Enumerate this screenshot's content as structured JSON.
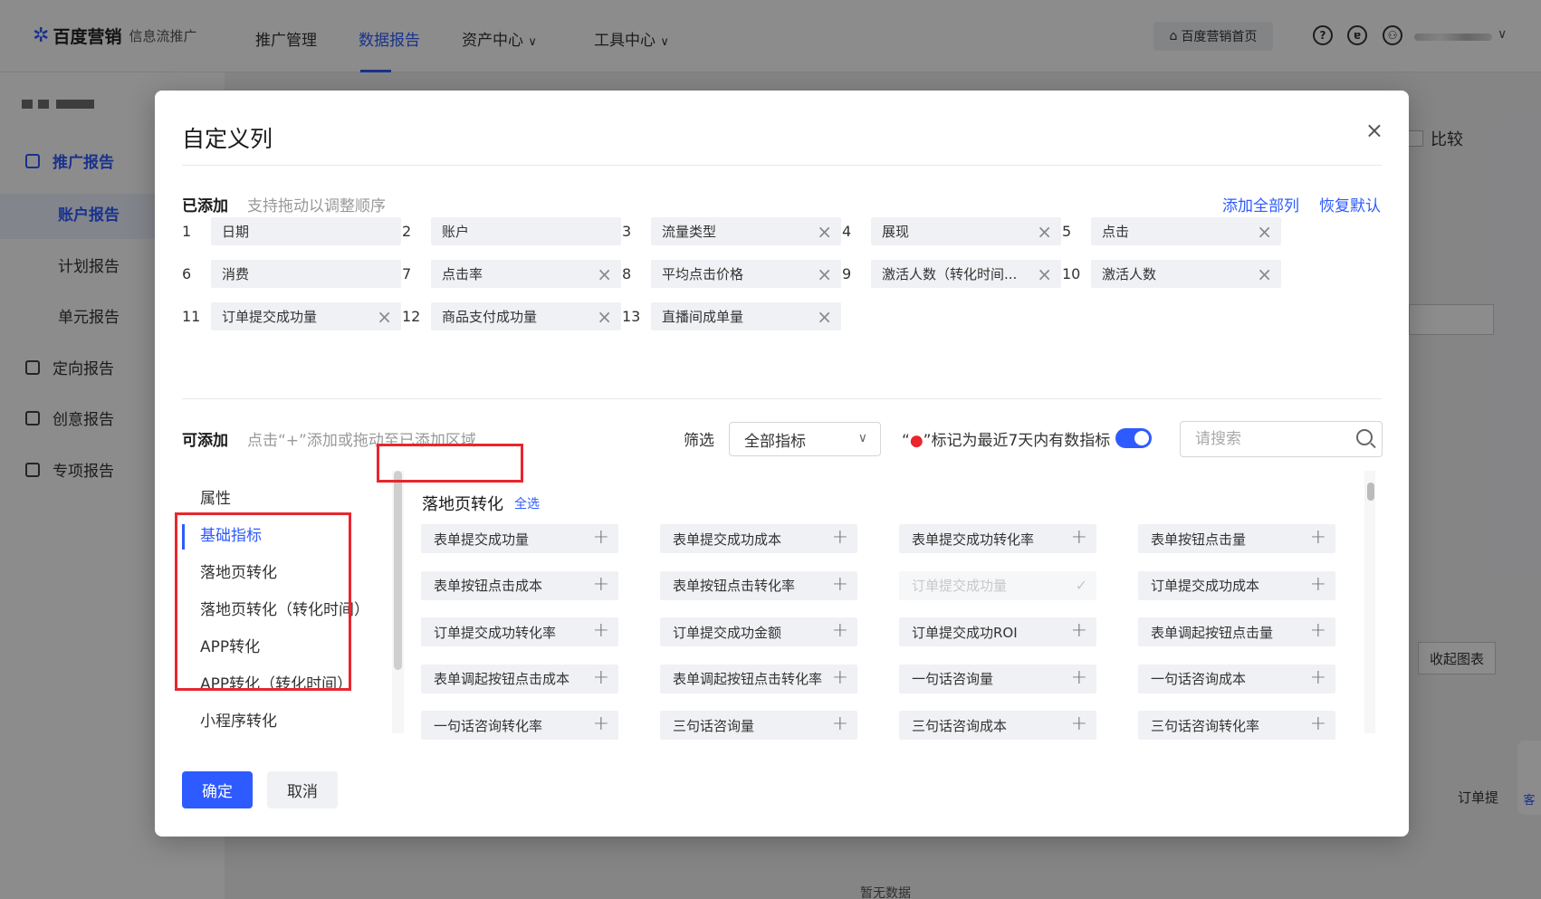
{
  "topbar": {
    "brand": "百度营销",
    "brand_sub": "信息流推广",
    "nav": [
      "推广管理",
      "数据报告",
      "资产中心",
      "工具中心"
    ],
    "active_nav": "数据报告",
    "home_button": "百度营销首页"
  },
  "sidebar": {
    "items": [
      "推广报告",
      "定向报告",
      "创意报告",
      "专项报告"
    ],
    "subitems": [
      "账户报告",
      "计划报告",
      "单元报告"
    ]
  },
  "background": {
    "compare_label": "比较",
    "collapse_chart": "收起图表",
    "column_label": "订单提",
    "no_data": "暂无数据",
    "help_text": "客"
  },
  "modal": {
    "title": "自定义列",
    "close_icon": "×",
    "added": {
      "label": "已添加",
      "hint": "支持拖动以调整顺序",
      "add_all": "添加全部列",
      "restore_default": "恢复默认",
      "columns": [
        {
          "num": "1",
          "name": "日期",
          "removable": false
        },
        {
          "num": "2",
          "name": "账户",
          "removable": false
        },
        {
          "num": "3",
          "name": "流量类型",
          "removable": true
        },
        {
          "num": "4",
          "name": "展现",
          "removable": true
        },
        {
          "num": "5",
          "name": "点击",
          "removable": true
        },
        {
          "num": "6",
          "name": "消费",
          "removable": false
        },
        {
          "num": "7",
          "name": "点击率",
          "removable": true
        },
        {
          "num": "8",
          "name": "平均点击价格",
          "removable": true
        },
        {
          "num": "9",
          "name": "激活人数（转化时间...",
          "removable": true
        },
        {
          "num": "10",
          "name": "激活人数",
          "removable": true
        },
        {
          "num": "11",
          "name": "订单提交成功量",
          "removable": true
        },
        {
          "num": "12",
          "name": "商品支付成功量",
          "removable": true
        },
        {
          "num": "13",
          "name": "直播间成单量",
          "removable": true
        }
      ]
    },
    "available": {
      "label": "可添加",
      "hint": "点击“+”添加或拖动至已添加区域",
      "filter_label": "筛选",
      "filter_value": "全部指标",
      "mark_prefix": "“",
      "mark_dot": "●",
      "mark_text": "”标记为最近7天内有数指标",
      "search_placeholder": "请搜索",
      "categories": [
        "属性",
        "基础指标",
        "落地页转化",
        "落地页转化（转化时间）",
        "APP转化",
        "APP转化（转化时间）",
        "小程序转化"
      ],
      "active_category": "基础指标",
      "group_title": "落地页转化",
      "select_all": "全选",
      "metrics": [
        {
          "name": "表单提交成功量",
          "disabled": false
        },
        {
          "name": "表单提交成功成本",
          "disabled": false
        },
        {
          "name": "表单提交成功转化率",
          "disabled": false
        },
        {
          "name": "表单按钮点击量",
          "disabled": false
        },
        {
          "name": "表单按钮点击成本",
          "disabled": false
        },
        {
          "name": "表单按钮点击转化率",
          "disabled": false
        },
        {
          "name": "订单提交成功量",
          "disabled": true
        },
        {
          "name": "订单提交成功成本",
          "disabled": false
        },
        {
          "name": "订单提交成功转化率",
          "disabled": false
        },
        {
          "name": "订单提交成功金额",
          "disabled": false
        },
        {
          "name": "订单提交成功ROI",
          "disabled": false
        },
        {
          "name": "表单调起按钮点击量",
          "disabled": false
        },
        {
          "name": "表单调起按钮点击成本",
          "disabled": false
        },
        {
          "name": "表单调起按钮点击转化率",
          "disabled": false
        },
        {
          "name": "一句话咨询量",
          "disabled": false
        },
        {
          "name": "一句话咨询成本",
          "disabled": false
        },
        {
          "name": "一句话咨询转化率",
          "disabled": false
        },
        {
          "name": "三句话咨询量",
          "disabled": false
        },
        {
          "name": "三句话咨询成本",
          "disabled": false
        },
        {
          "name": "三句话咨询转化率",
          "disabled": false
        }
      ]
    },
    "confirm": "确定",
    "cancel": "取消"
  },
  "colors": {
    "accent": "#2e5bff",
    "highlight_box": "#e8262d"
  }
}
